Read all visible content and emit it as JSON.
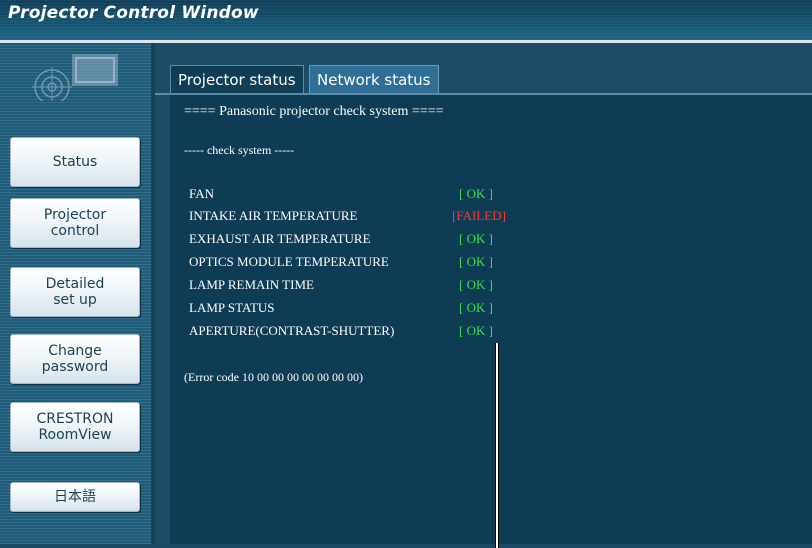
{
  "window": {
    "title": "Projector Control Window"
  },
  "sidebar": {
    "buttons": [
      {
        "label": "Status"
      },
      {
        "label": "Projector\ncontrol"
      },
      {
        "label": "Detailed\nset up"
      },
      {
        "label": "Change\npassword"
      },
      {
        "label": "CRESTRON\nRoomView"
      },
      {
        "label": "日本語"
      }
    ]
  },
  "tabs": [
    {
      "label": "Projector status",
      "active": true
    },
    {
      "label": "Network status",
      "active": false
    }
  ],
  "status": {
    "header": "==== Panasonic projector check system ====",
    "subheader": "----- check system -----",
    "items": [
      {
        "label": "FAN",
        "value": "[ OK ]",
        "state": "ok"
      },
      {
        "label": "INTAKE AIR TEMPERATURE",
        "value": "[FAILED]",
        "state": "failed"
      },
      {
        "label": "EXHAUST AIR TEMPERATURE",
        "value": "[ OK ]",
        "state": "ok"
      },
      {
        "label": "OPTICS MODULE TEMPERATURE",
        "value": "[ OK ]",
        "state": "ok"
      },
      {
        "label": "LAMP REMAIN TIME",
        "value": "[ OK ]",
        "state": "ok"
      },
      {
        "label": "LAMP STATUS",
        "value": "[ OK ]",
        "state": "ok"
      },
      {
        "label": "APERTURE(CONTRAST-SHUTTER)",
        "value": "[ OK ]",
        "state": "ok"
      }
    ],
    "error_code": "(Error code 10 00 00 00 00 00 00 00)"
  },
  "colors": {
    "ok": "#33e24a",
    "failed": "#ff3535",
    "background": "#1b4d67"
  }
}
